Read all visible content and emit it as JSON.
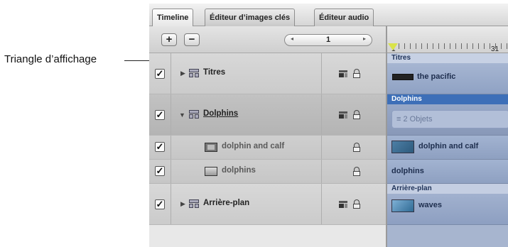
{
  "callout": {
    "label": "Triangle d’affichage"
  },
  "tabs": [
    {
      "label": "Timeline",
      "active": true
    },
    {
      "label": "Éditeur d’images clés",
      "active": false
    },
    {
      "label": "Éditeur audio",
      "active": false
    }
  ],
  "toolbar": {
    "add_label": "+",
    "remove_label": "−",
    "frame_value": "1",
    "prev_arrow": "◂",
    "next_arrow": "▸"
  },
  "ruler": {
    "tick_labels": [
      "1",
      "31"
    ]
  },
  "layers": [
    {
      "name": "Titres",
      "kind": "group",
      "expanded": false,
      "checked": true
    },
    {
      "name": "Dolphins",
      "kind": "group",
      "expanded": true,
      "checked": true
    },
    {
      "name": "dolphin and calf",
      "kind": "video",
      "checked": true
    },
    {
      "name": "dolphins",
      "kind": "image",
      "checked": true
    },
    {
      "name": "Arrière-plan",
      "kind": "group",
      "expanded": false,
      "checked": true
    }
  ],
  "timeline": {
    "tracks": [
      {
        "header": "Titres",
        "clip": "the pacific"
      },
      {
        "header": "Dolphins",
        "clip": "2 Objets"
      },
      {
        "header": "",
        "clip": "dolphin and calf"
      },
      {
        "header": "",
        "clip": "dolphins"
      },
      {
        "header": "Arrière-plan",
        "clip": "waves"
      }
    ]
  },
  "icons": {
    "checkbox": "checkmark-icon",
    "collapsed": "disclosure-triangle-right-icon",
    "expanded": "disclosure-triangle-down-icon",
    "group": "layer-group-icon",
    "lock": "lock-icon",
    "mask": "mask-icon"
  }
}
